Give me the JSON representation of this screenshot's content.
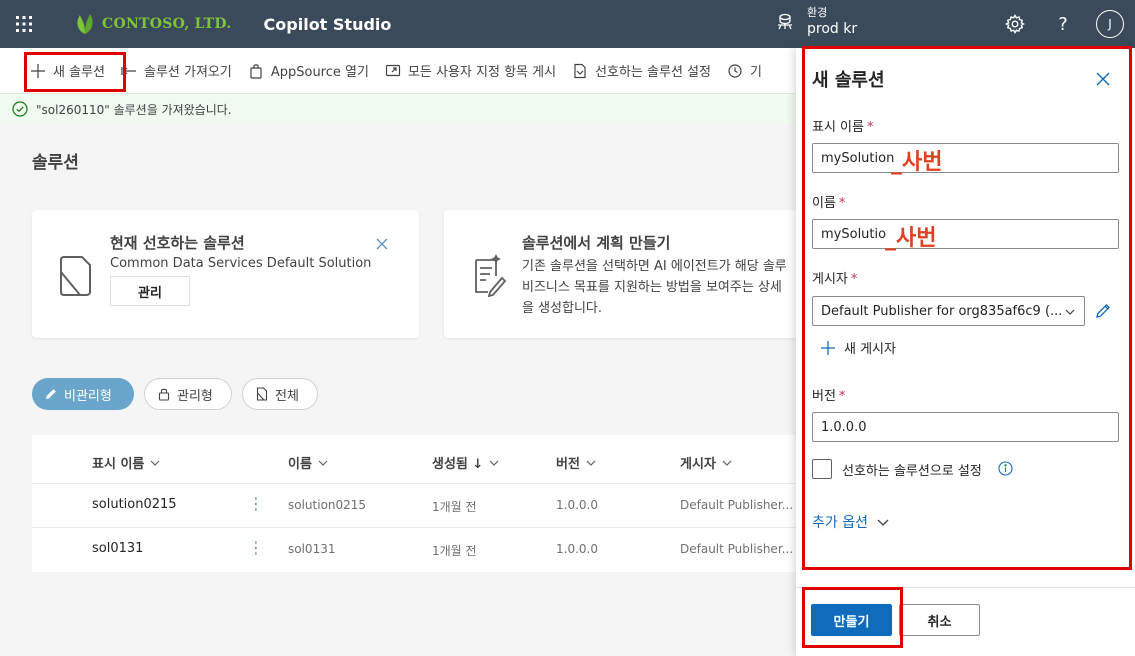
{
  "header": {
    "company": "CONTOSO, LTD.",
    "app_title": "Copilot Studio",
    "env_label": "환경",
    "env_value": "prod kr",
    "avatar_initial": "J"
  },
  "commands": {
    "new_solution": "새 솔루션",
    "import_solution": "솔루션 가져오기",
    "appsource": "AppSource 열기",
    "publish_all": "모든 사용자 지정 항목 게시",
    "preferred_settings": "선호하는 솔루션 설정",
    "history": "기"
  },
  "notification": {
    "message": "\"sol260110\" 솔루션을 가져왔습니다."
  },
  "page": {
    "title": "솔루션"
  },
  "preferred_card": {
    "title": "현재 선호하는 솔루션",
    "subtitle": "Common Data Services Default Solution",
    "button": "관리"
  },
  "plan_card": {
    "title": "솔루션에서 계획 만들기",
    "line1": "기존 솔루션을 선택하면 AI 에이전트가 해당 솔루",
    "line2": "비즈니스 목표를 지원하는 방법을 보여주는 상세",
    "line3": "을 생성합니다."
  },
  "filters": {
    "unmanaged": "비관리형",
    "managed": "관리형",
    "all": "전체"
  },
  "table": {
    "columns": {
      "display_name": "표시 이름",
      "name": "이름",
      "created": "생성됨 ↓",
      "version": "버전",
      "publisher": "게시자"
    },
    "rows": [
      {
        "display_name": "solution0215",
        "name": "solution0215",
        "created": "1개월 전",
        "version": "1.0.0.0",
        "publisher": "Default Publisher..."
      },
      {
        "display_name": "sol0131",
        "name": "sol0131",
        "created": "1개월 전",
        "version": "1.0.0.0",
        "publisher": "Default Publisher..."
      }
    ]
  },
  "panel": {
    "title": "새 솔루션",
    "display_name_label": "표시 이름",
    "display_name_value": "mySolution",
    "display_name_suffix": "_사번",
    "name_label": "이름",
    "name_value": "mySolutio",
    "name_suffix": "_사번",
    "required_mark": "*",
    "publisher_label": "게시자",
    "publisher_value": "Default Publisher for org835af6c9 (...",
    "new_publisher": "새 게시자",
    "version_label": "버전",
    "version_value": "1.0.0.0",
    "preferred_checkbox": "선호하는 솔루션으로 설정",
    "more_options": "추가 옵션",
    "create_button": "만들기",
    "cancel_button": "취소"
  },
  "colors": {
    "header_bg": "#3b4a5a",
    "accent": "#0f6cbd",
    "highlight": "#e00000",
    "logo_green": "#7ec43a"
  }
}
